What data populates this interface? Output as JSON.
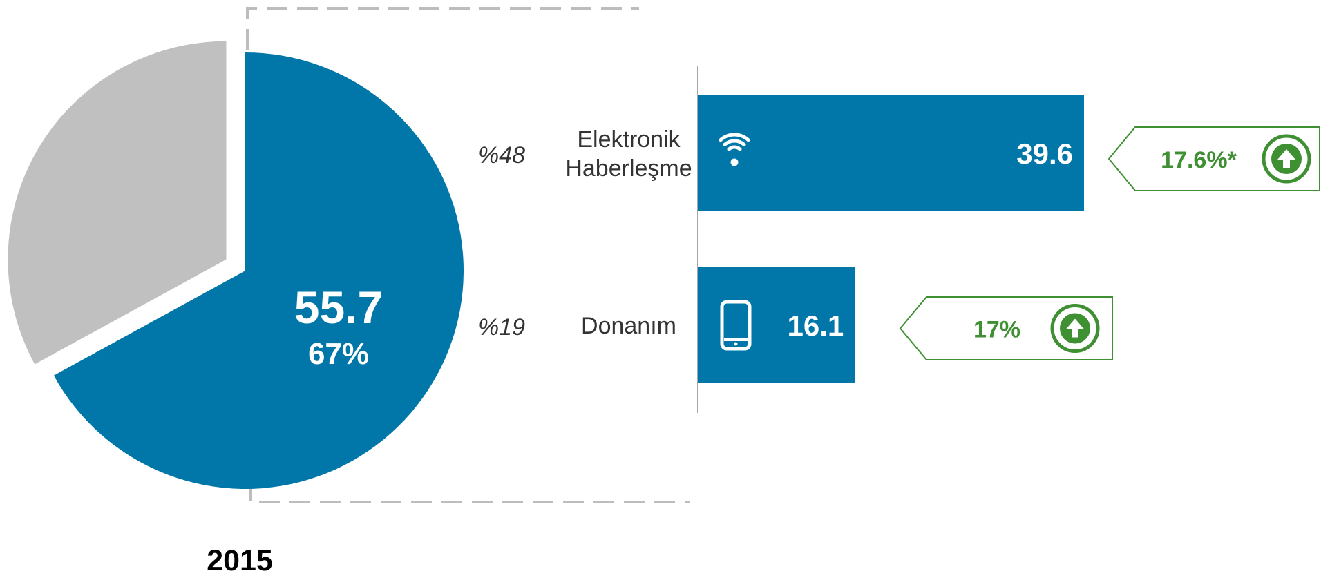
{
  "colors": {
    "primary": "#0077a8",
    "secondary": "#c0c0c0",
    "growth": "#3f8f33",
    "connector": "#bdbdbd",
    "axis": "#a6a6a6",
    "text": "#333333"
  },
  "year_label": "2015",
  "chart_data": [
    {
      "type": "pie",
      "slices": [
        {
          "value": 55.7,
          "percent": 67,
          "value_label": "55.7",
          "percent_label": "67%",
          "color": "#0077a8",
          "exploded": false
        },
        {
          "value": 27.4,
          "percent": 33,
          "color": "#c0c0c0",
          "exploded": true
        }
      ]
    },
    {
      "type": "bar",
      "orientation": "horizontal",
      "categories": [
        "Elektronik Haberleşme",
        "Donanım"
      ],
      "category_lines": [
        [
          "Elektronik",
          "Haberleşme"
        ],
        [
          "Donanım"
        ]
      ],
      "values": [
        39.6,
        16.1
      ],
      "value_labels": [
        "39.6",
        "16.1"
      ],
      "share_labels": [
        "%48",
        "%19"
      ],
      "icons": [
        "wifi-icon",
        "smartphone-icon"
      ],
      "growth_labels": [
        "17.6%*",
        "17%"
      ],
      "growth_icons": [
        "arrow-up-circle-icon",
        "arrow-up-circle-icon"
      ],
      "xlim": [
        0,
        39.6
      ]
    }
  ]
}
